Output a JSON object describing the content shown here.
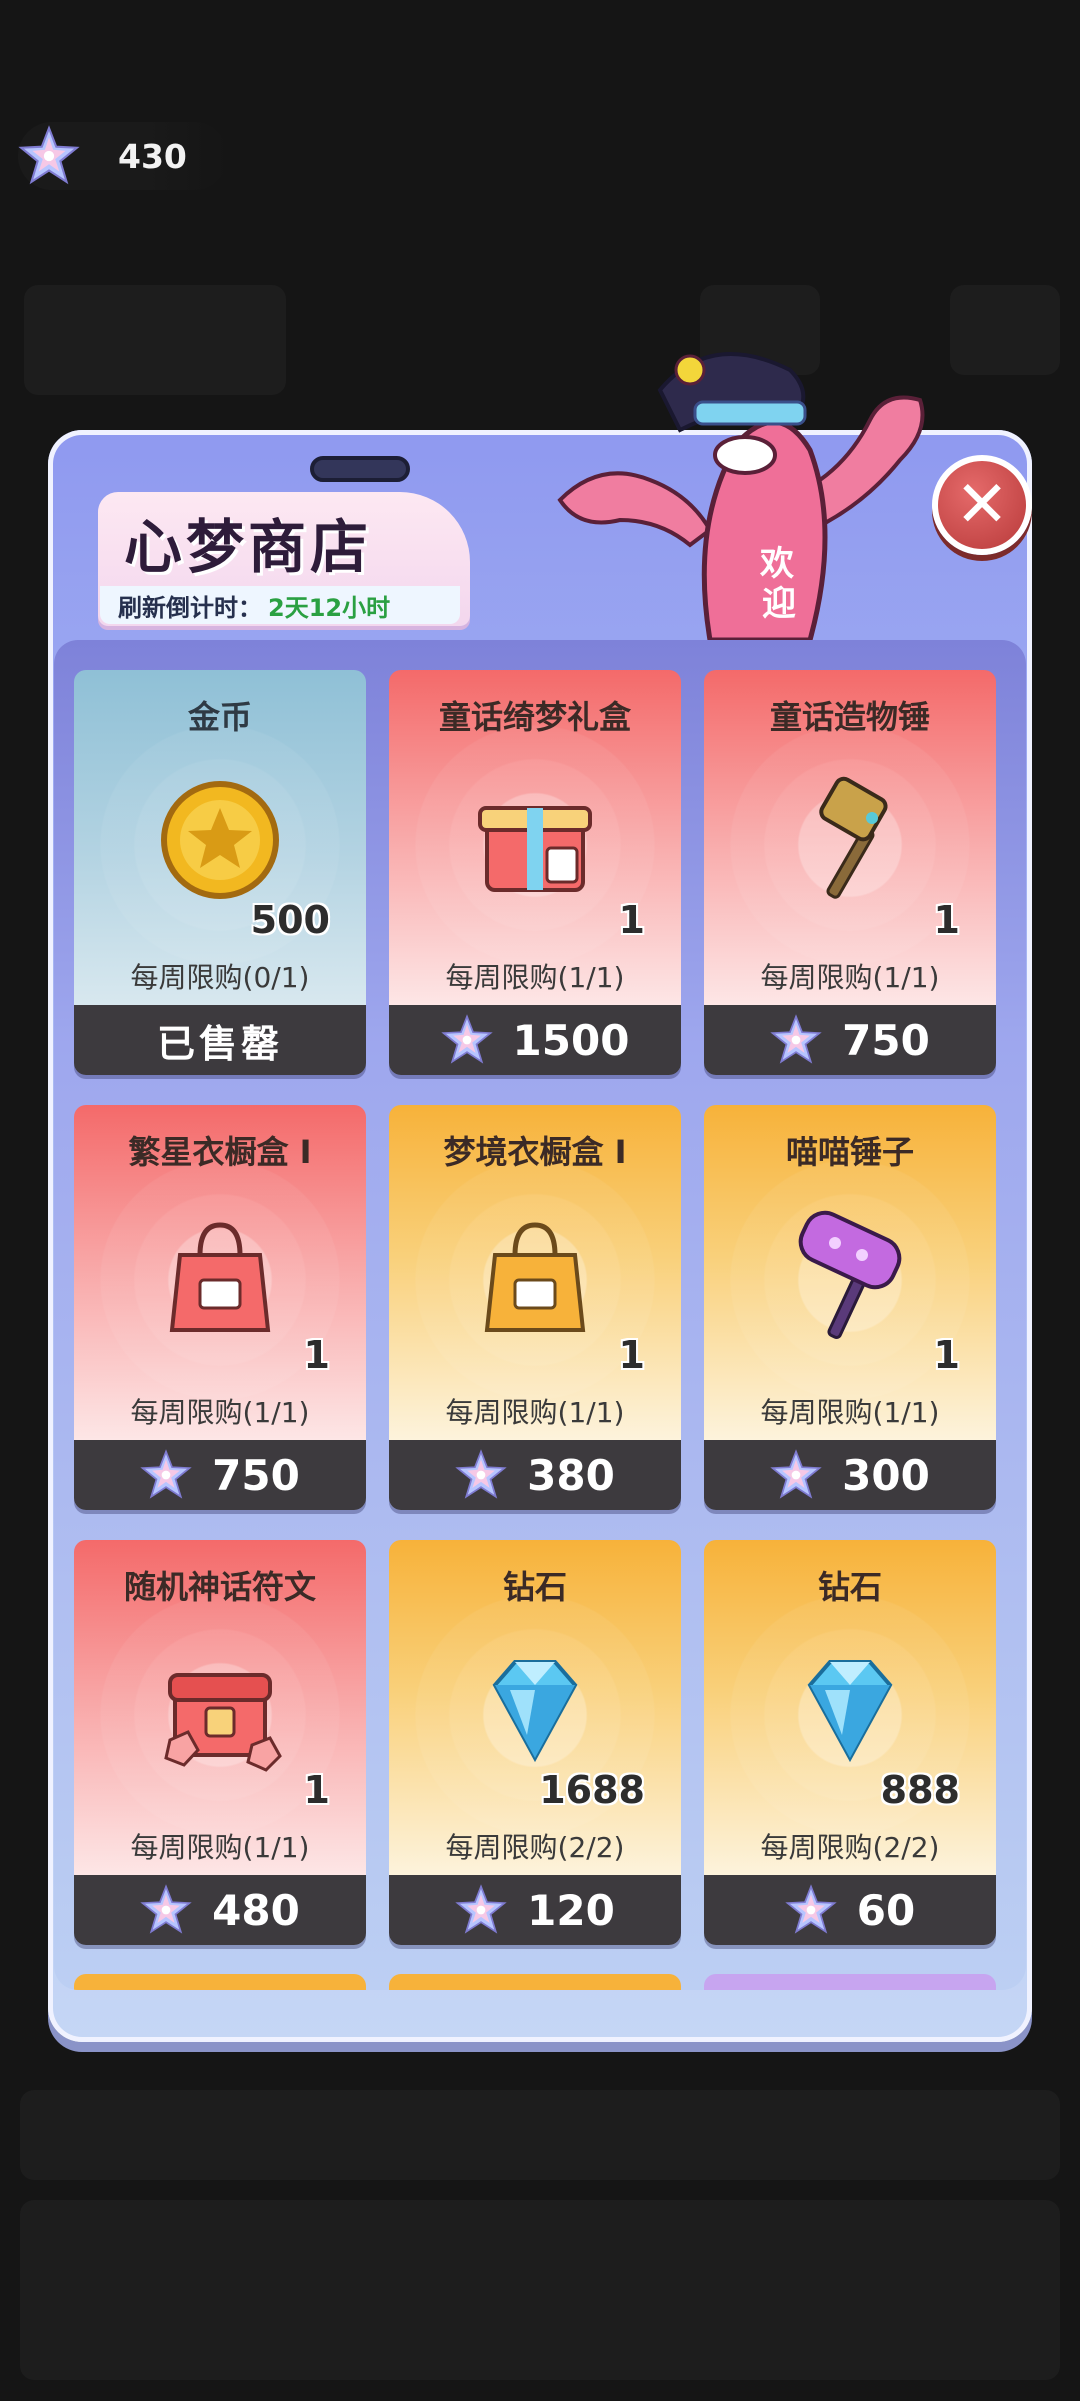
{
  "currency": {
    "icon": "star-crystal-icon",
    "amount": "430"
  },
  "shop": {
    "title": "心梦商店",
    "refresh_label": "刷新倒计时：",
    "refresh_value": "2天12小时"
  },
  "close": {
    "icon": "close-icon",
    "glyph": "✕"
  },
  "items": [
    {
      "name": "金币",
      "icon": "gold-coin-icon",
      "qty": "500",
      "limit": "每周限购(0/1)",
      "price": "已售罄",
      "sold_out": true,
      "theme": "blue"
    },
    {
      "name": "童话绮梦礼盒",
      "icon": "gift-box-icon",
      "qty": "1",
      "limit": "每周限购(1/1)",
      "price": "1500",
      "sold_out": false,
      "theme": "red"
    },
    {
      "name": "童话造物锤",
      "icon": "hammer-icon",
      "qty": "1",
      "limit": "每周限购(1/1)",
      "price": "750",
      "sold_out": false,
      "theme": "red"
    },
    {
      "name": "繁星衣橱盒 I",
      "icon": "red-bag-icon",
      "qty": "1",
      "limit": "每周限购(1/1)",
      "price": "750",
      "sold_out": false,
      "theme": "red"
    },
    {
      "name": "梦境衣橱盒 I",
      "icon": "gold-bag-icon",
      "qty": "1",
      "limit": "每周限购(1/1)",
      "price": "380",
      "sold_out": false,
      "theme": "gold"
    },
    {
      "name": "喵喵锤子",
      "icon": "cat-hammer-icon",
      "qty": "1",
      "limit": "每周限购(1/1)",
      "price": "300",
      "sold_out": false,
      "theme": "gold"
    },
    {
      "name": "随机神话符文",
      "icon": "rune-chest-icon",
      "qty": "1",
      "limit": "每周限购(1/1)",
      "price": "480",
      "sold_out": false,
      "theme": "red"
    },
    {
      "name": "钻石",
      "icon": "diamond-icon",
      "qty": "1688",
      "limit": "每周限购(2/2)",
      "price": "120",
      "sold_out": false,
      "theme": "gold"
    },
    {
      "name": "钻石",
      "icon": "diamond-icon",
      "qty": "888",
      "limit": "每周限购(2/2)",
      "price": "60",
      "sold_out": false,
      "theme": "gold"
    }
  ],
  "price_icon": "star-crystal-icon"
}
